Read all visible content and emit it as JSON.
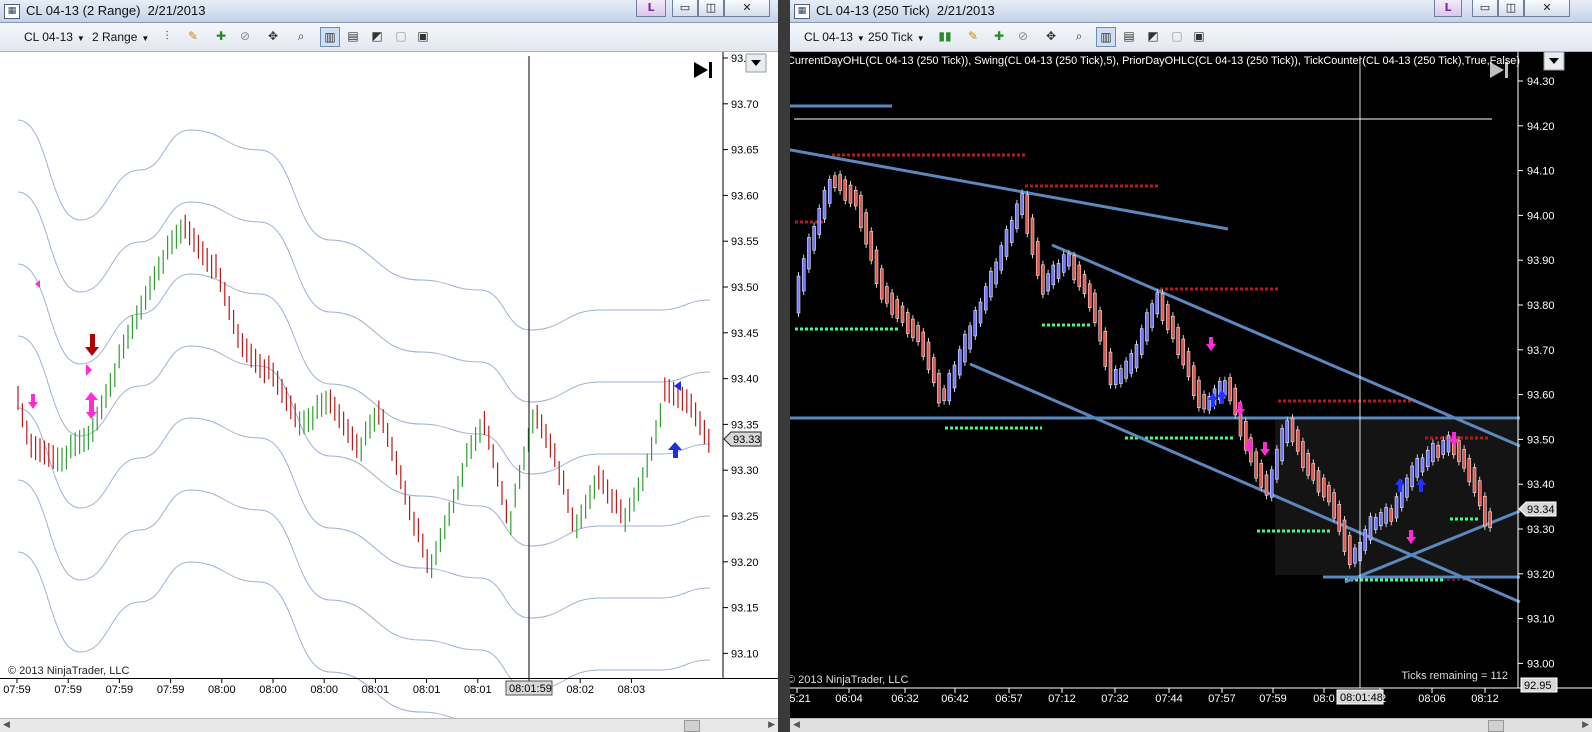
{
  "left_window": {
    "title": "CL 04-13 (2 Range)  2/21/2013",
    "toolbar": {
      "instrument": "CL 04-13",
      "interval": "2 Range"
    },
    "chart": {
      "y_labels": [
        "93.",
        "93.70",
        "93.65",
        "93.60",
        "93.55",
        "93.50",
        "93.45",
        "93.40",
        "93.35",
        "93.30",
        "93.25",
        "93.20",
        "93.15",
        "93.10"
      ],
      "x_labels": [
        "07:59",
        "07:59",
        "07:59",
        "07:59",
        "08:00",
        "08:00",
        "08:00",
        "08:01",
        "08:01",
        "08:01",
        "08:02",
        "08:02",
        "08:03"
      ],
      "cursor_time": "08:01:59",
      "last_price": "93.33",
      "copyright": "© 2013 NinjaTrader, LLC"
    }
  },
  "right_window": {
    "title": "CL 04-13 (250 Tick)  2/21/2013",
    "toolbar": {
      "instrument": "CL 04-13",
      "interval": "250 Tick"
    },
    "chart": {
      "indicators": "CurrentDayOHL(CL 04-13 (250 Tick)), Swing(CL 04-13 (250 Tick),5), PriorDayOHLC(CL 04-13 (250 Tick)), TickCounter(CL 04-13 (250 Tick),True,False)",
      "y_labels": [
        "94.30",
        "94.20",
        "94.10",
        "94.00",
        "93.90",
        "93.80",
        "93.70",
        "93.60",
        "93.50",
        "93.40",
        "93.30",
        "93.20",
        "93.10",
        "93.00"
      ],
      "x_labels": [
        "05:21",
        "06:04",
        "06:32",
        "06:42",
        "06:57",
        "07:12",
        "07:32",
        "07:44",
        "07:57",
        "07:59",
        "08:0",
        "02",
        "08:06",
        "08:12"
      ],
      "cursor_time": "08:01:48",
      "last_price": "93.34",
      "bottom_price": "92.95",
      "ticks_remaining": "Ticks remaining = 112",
      "copyright": "© 2013 NinjaTrader, LLC"
    }
  },
  "colors": {
    "up_bar_left": "#2ea02e",
    "down_bar_left": "#c01818",
    "band_line": "#9fb2d2",
    "up_candle": "#6f74ff",
    "down_candle": "#e0554e",
    "trendline": "#5b88bd",
    "swing_high": "#b3191f",
    "swing_low": "#39ff84"
  }
}
